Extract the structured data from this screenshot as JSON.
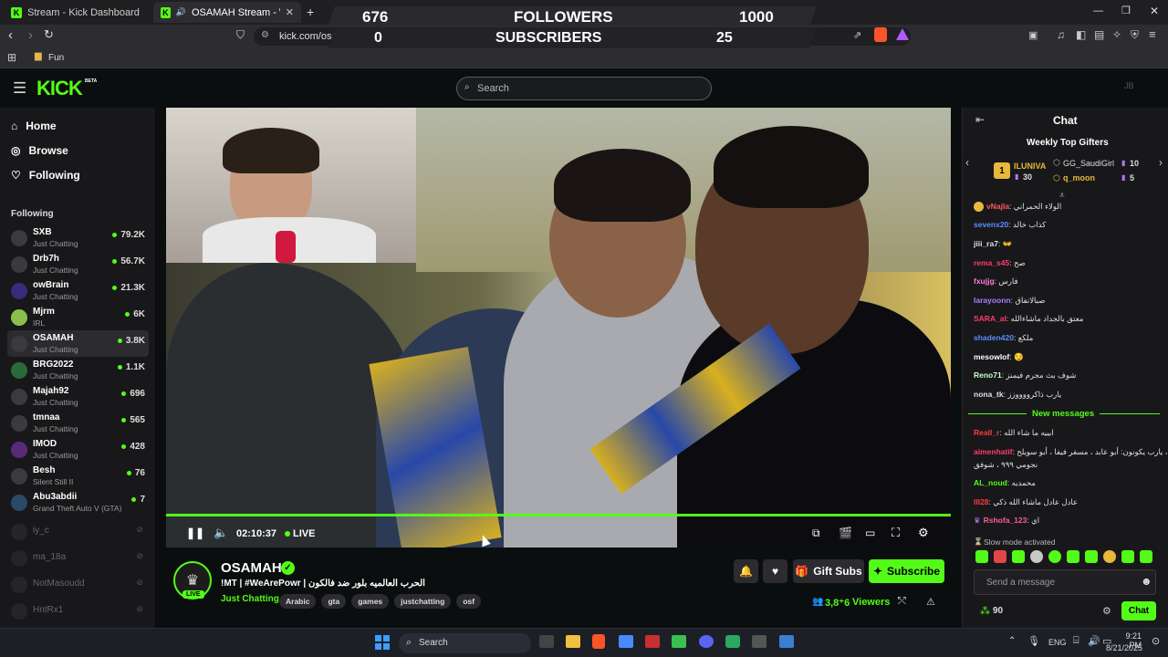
{
  "browser": {
    "tabs": [
      {
        "title": "Stream - Kick Dashboard"
      },
      {
        "title": "OSAMAH Stream - Watch Liv"
      }
    ],
    "new_tab": "+",
    "url": "kick.com/osamah",
    "bookmark": "Fun"
  },
  "overlay": {
    "followers_current": "676",
    "followers_label": "FOLLOWERS",
    "followers_goal": "1000",
    "subs_current": "0",
    "subs_label": "SUBSCRIBERS",
    "subs_goal": "25"
  },
  "header": {
    "logo": "KICK",
    "logo_badge": "BETA",
    "search_placeholder": "Search",
    "avatar_initials": "JB"
  },
  "sidebar": {
    "nav": [
      {
        "label": "Home",
        "icon": "home-icon"
      },
      {
        "label": "Browse",
        "icon": "compass-icon"
      },
      {
        "label": "Following",
        "icon": "heart-icon"
      }
    ],
    "following_heading": "Following",
    "channels": [
      {
        "name": "SXB",
        "category": "Just Chatting",
        "viewers": "79.2K"
      },
      {
        "name": "Drb7h",
        "category": "Just Chatting",
        "viewers": "56.7K"
      },
      {
        "name": "owBrain",
        "category": "Just Chatting",
        "viewers": "21.3K"
      },
      {
        "name": "Mjrm",
        "category": "IRL",
        "viewers": "6K"
      },
      {
        "name": "OSAMAH",
        "category": "Just Chatting",
        "viewers": "3.8K"
      },
      {
        "name": "BRG2022",
        "category": "Just Chatting",
        "viewers": "1.1K"
      },
      {
        "name": "Majah92",
        "category": "Just Chatting",
        "viewers": "696"
      },
      {
        "name": "tmnaa",
        "category": "Just Chatting",
        "viewers": "565"
      },
      {
        "name": "IMOD",
        "category": "Just Chatting",
        "viewers": "428"
      },
      {
        "name": "Besh",
        "category": "Silent Still II",
        "viewers": "76"
      },
      {
        "name": "Abu3abdii",
        "category": "Grand Theft Auto V (GTA)",
        "viewers": "7"
      }
    ],
    "offline": [
      {
        "name": "iy_c"
      },
      {
        "name": "ma_18a"
      },
      {
        "name": "NotMasoudd"
      },
      {
        "name": "HntRx1"
      }
    ]
  },
  "player": {
    "time": "02:10:37",
    "live": "LIVE"
  },
  "stream": {
    "streamer": "OSAMAH",
    "live_badge": "LIVE",
    "title": "!MT | #WeArePowr | الحرب العالميه بلور ضد فالكون",
    "category": "Just Chatting",
    "tags": [
      "Arabic",
      "gta",
      "games",
      "justchatting",
      "osf"
    ],
    "gift_label": "Gift Subs",
    "subscribe_label": "Subscribe",
    "viewers": "3,8⁺6",
    "viewers_label": "Viewers"
  },
  "chat": {
    "title": "Chat",
    "top_gifters_title": "Weekly Top Gifters",
    "gifters": [
      {
        "rank": "1",
        "name": "ILUNIVA",
        "count": "30"
      },
      {
        "name": "GG_SaudiGirl",
        "count": "10"
      },
      {
        "name": "q_moon",
        "count": "5"
      }
    ],
    "messages": [
      {
        "user": "vNajla",
        "text": "الولاء الحمراني",
        "color": "#ff5a5a"
      },
      {
        "user": "sevenx20",
        "text": "كذاب خالد",
        "color": "#5b8cff"
      },
      {
        "user": "jiii_ra7",
        "text": "👐",
        "color": "#e0e0e0"
      },
      {
        "user": "rema_s45",
        "text": "صح",
        "color": "#ff3b6b"
      },
      {
        "user": "fxujjg",
        "text": "فارس",
        "color": "#ff7ad9"
      },
      {
        "user": "larayoonn",
        "text": "صبالاتفاق",
        "color": "#b27aff"
      },
      {
        "user": "SARA_al",
        "text": "معتق بالجداد ماشاءالله",
        "color": "#ff3b6b"
      },
      {
        "user": "shaden420",
        "text": "ملكع",
        "color": "#5b8cff"
      },
      {
        "user": "mesowlof",
        "text": "😏",
        "color": "#ffffff"
      },
      {
        "user": "Reno71",
        "text": "شوف بث مجرم فيمنز",
        "color": "#c8ffc8"
      },
      {
        "user": "nona_tk",
        "text": "يارب ذاكرووووزز",
        "color": "#e0e0e0"
      }
    ],
    "new_messages_label": "New messages",
    "new_messages": [
      {
        "user": "Reall_r",
        "text": "ابييه ما شاء الله",
        "color": "#ff3b3b"
      },
      {
        "user": "aimenhatif",
        "text": "يارب يكونون: أبو عابد ، مسفر فيفا ، أبو سويلح ،",
        "color": "#ff3b6b"
      },
      {
        "user": "",
        "text": "نجومي ٩٩٩ ، شوفق",
        "color": "#e0e0e0"
      },
      {
        "user": "AL_noud",
        "text": "محمديه",
        "color": "#53fc18"
      },
      {
        "user": "lll28",
        "text": "عادل عادل ماشاء الله ذكي",
        "color": "#ff3b3b"
      },
      {
        "user": "Rshofa_123",
        "text": "اي",
        "color": "#ff5a9a"
      }
    ],
    "slow_mode": "Slow mode activated",
    "input_placeholder": "Send a message",
    "points": "90",
    "chat_button": "Chat"
  },
  "taskbar": {
    "search": "Search",
    "lang": "ENG",
    "time": "9:21 PM",
    "date": "8/21/2025"
  },
  "colors": {
    "kick_green": "#53fc18",
    "bg": "#0b0e0f",
    "panel": "#18181b"
  }
}
